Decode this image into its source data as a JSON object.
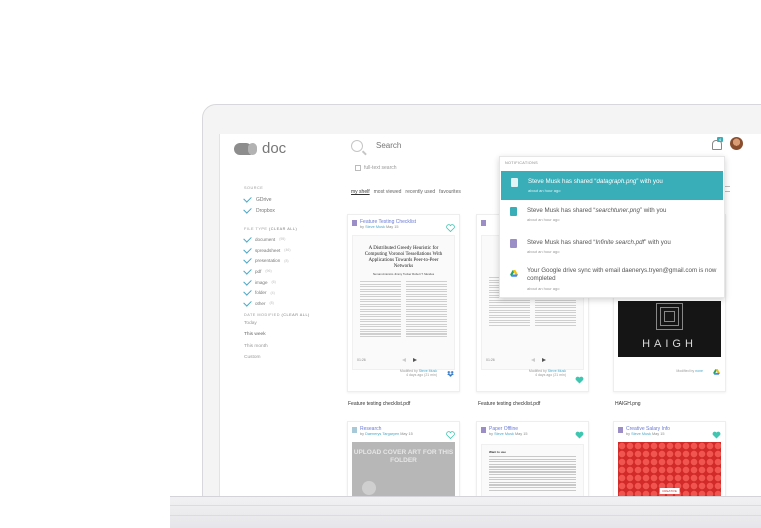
{
  "app": {
    "logo_text": "doc"
  },
  "search": {
    "placeholder": "Search",
    "fulltext_label": "full-text search"
  },
  "notifications_badge": "4",
  "sidebar": {
    "source_title": "SOURCE",
    "sources": [
      {
        "label": "GDrive"
      },
      {
        "label": "Dropbox"
      }
    ],
    "filetype_title": "FILE TYPE",
    "filetype_filter": "(Clear all)",
    "filetypes": [
      {
        "label": "document",
        "count": "(95)"
      },
      {
        "label": "spreadsheet",
        "count": "(46)"
      },
      {
        "label": "presentation",
        "count": "(8)"
      },
      {
        "label": "pdf",
        "count": "(96)"
      },
      {
        "label": "image",
        "count": "(6)"
      },
      {
        "label": "folder",
        "count": "(4)"
      },
      {
        "label": "other",
        "count": "(8)"
      }
    ],
    "date_title": "DATE MODIFIED",
    "date_filter": "(Clear all)",
    "dates": [
      {
        "label": "Today"
      },
      {
        "label": "This week"
      },
      {
        "label": "This month"
      },
      {
        "label": "Custom"
      }
    ]
  },
  "tabs": [
    {
      "label": "my shelf"
    },
    {
      "label": "most viewed"
    },
    {
      "label": "recently used"
    },
    {
      "label": "favourites"
    }
  ],
  "cards": [
    {
      "title": "Feature Testing Checklist",
      "by": "by",
      "author": "Steve Musk",
      "date": "May 15",
      "paper_title": "A Distributed Greedy Heuristic for Computing Voronoi Tessellations With Applications Towards Peer-to-Peer Networks",
      "paper_authors": "Suman Antonnio   Jimmy Tucker   Robert T. Mendes",
      "time": "01:26",
      "modified_label": "Modified by",
      "modified_by": "Steve Musk",
      "modified_ago": "4 days ago (21 min)",
      "filename": "Feature testing checklist.pdf"
    },
    {
      "time": "01:26",
      "modified_label": "Modified by",
      "modified_by": "Steve Musk",
      "modified_ago": "4 days ago (21 min)",
      "filename": "Feature testing checklist.pdf"
    },
    {
      "modified_label": "Modified by",
      "modified_by": "none",
      "filename": "HAIGH.png",
      "image_word": "HAIGH"
    },
    {
      "title": "Research",
      "by": "by",
      "author": "Daenerys Targaryen",
      "date": "May 15",
      "upload_text": "UPLOAD COVER ART FOR THIS FOLDER"
    },
    {
      "title": "Paper Offline",
      "by": "by",
      "author": "Steve Musk",
      "date": "May 15",
      "heading": "Want to use"
    },
    {
      "title": "Creative Salary Info",
      "by": "by",
      "author": "Steve Musk",
      "date": "May 15",
      "tag": "CREATIVE"
    }
  ],
  "notifications": {
    "title": "NOTIFICATIONS",
    "items": [
      {
        "pre": "Steve Musk has shared “",
        "file": "datagraph.png",
        "post": "” with you",
        "ago": "about an hour ago"
      },
      {
        "pre": "Steve Musk has shared “",
        "file": "searchtuner.png",
        "post": "” with you",
        "ago": "about an hour ago"
      },
      {
        "pre": "Steve Musk has shared “",
        "file": "Infinite search.pdf",
        "post": "” with you",
        "ago": "about an hour ago"
      },
      {
        "text": "Your Google drive sync with email daenerys.tryen@gmail.com is now completed",
        "ago": "about an hour ago"
      }
    ]
  },
  "colors": {
    "accent": "#3aaeb8",
    "link": "#49a7c9",
    "heart": "#3fc6b0",
    "title": "#6b7bd6"
  }
}
